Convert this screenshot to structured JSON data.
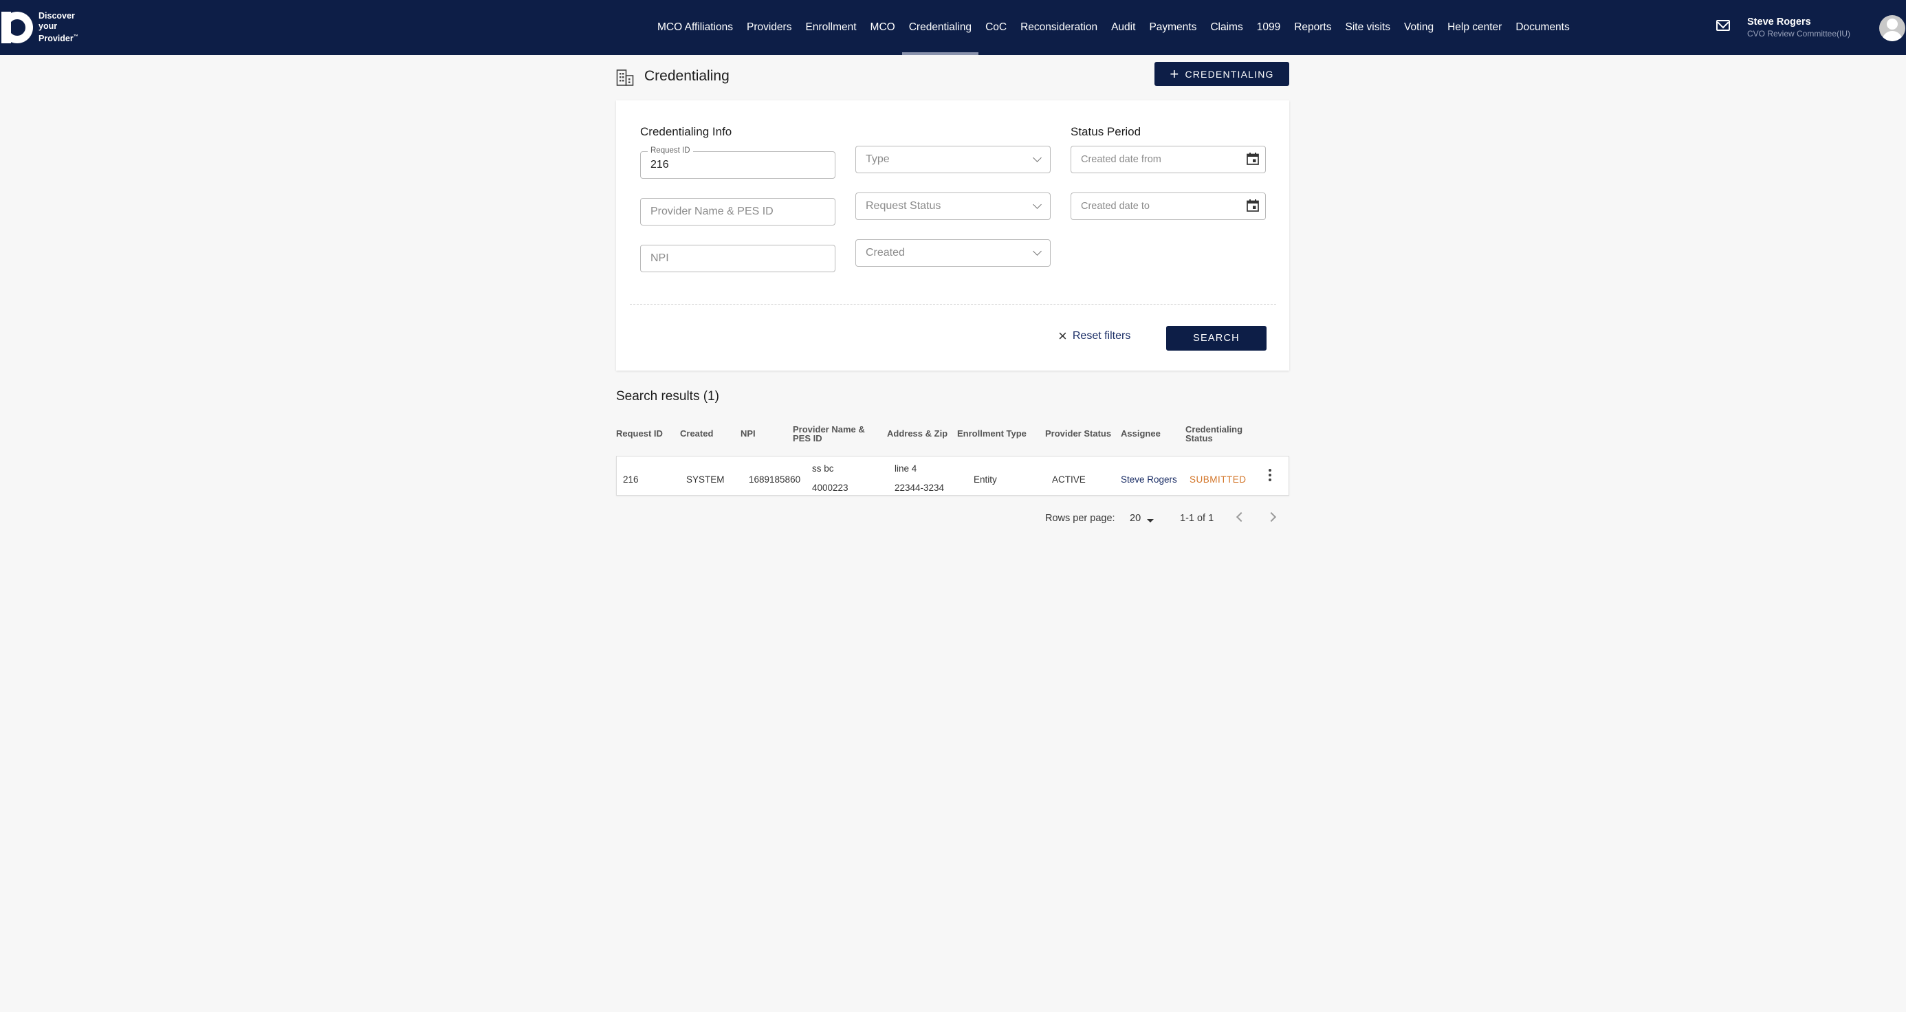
{
  "brand": {
    "line1": "Discover",
    "line2": "your",
    "line3": "Provider"
  },
  "nav": [
    {
      "label": "MCO Affiliations",
      "active": false
    },
    {
      "label": "Providers",
      "active": false
    },
    {
      "label": "Enrollment",
      "active": false
    },
    {
      "label": "MCO",
      "active": false
    },
    {
      "label": "Credentialing",
      "active": true
    },
    {
      "label": "CoC",
      "active": false
    },
    {
      "label": "Reconsideration",
      "active": false
    },
    {
      "label": "Audit",
      "active": false
    },
    {
      "label": "Payments",
      "active": false
    },
    {
      "label": "Claims",
      "active": false
    },
    {
      "label": "1099",
      "active": false
    },
    {
      "label": "Reports",
      "active": false
    },
    {
      "label": "Site visits",
      "active": false
    },
    {
      "label": "Voting",
      "active": false
    },
    {
      "label": "Help center",
      "active": false
    },
    {
      "label": "Documents",
      "active": false
    }
  ],
  "user": {
    "name": "Steve Rogers",
    "role": "CVO Review Committee(IU)"
  },
  "page": {
    "title": "Credentialing",
    "new_button": "CREDENTIALING"
  },
  "filters": {
    "info_title": "Credentialing Info",
    "status_title": "Status Period",
    "request_id_label": "Request ID",
    "request_id_value": "216",
    "provider_placeholder": "Provider Name & PES ID",
    "npi_placeholder": "NPI",
    "type_placeholder": "Type",
    "request_status_placeholder": "Request Status",
    "created_placeholder": "Created",
    "date_from_placeholder": "Created date from",
    "date_to_placeholder": "Created date to",
    "reset_label": "Reset filters",
    "search_label": "SEARCH"
  },
  "results": {
    "title": "Search results (1)",
    "headers": {
      "request_id": "Request ID",
      "created": "Created",
      "npi": "NPI",
      "provider_1": "Provider Name &",
      "provider_2": "PES ID",
      "address": "Address & Zip",
      "enrollment_type": "Enrollment Type",
      "provider_status": "Provider Status",
      "assignee": "Assignee",
      "cred_status_1": "Credentialing",
      "cred_status_2": "Status"
    },
    "rows": [
      {
        "request_id": "216",
        "created": "SYSTEM",
        "npi": "1689185860",
        "provider_name": "ss bc",
        "pes_id": "4000223",
        "address": "line 4",
        "zip": "22344-3234",
        "enrollment_type": "Entity",
        "provider_status": "ACTIVE",
        "assignee": "Steve Rogers",
        "cred_status": "SUBMITTED"
      }
    ]
  },
  "pagination": {
    "rows_label": "Rows per page:",
    "rows_value": "20",
    "range": "1-1 of 1"
  }
}
